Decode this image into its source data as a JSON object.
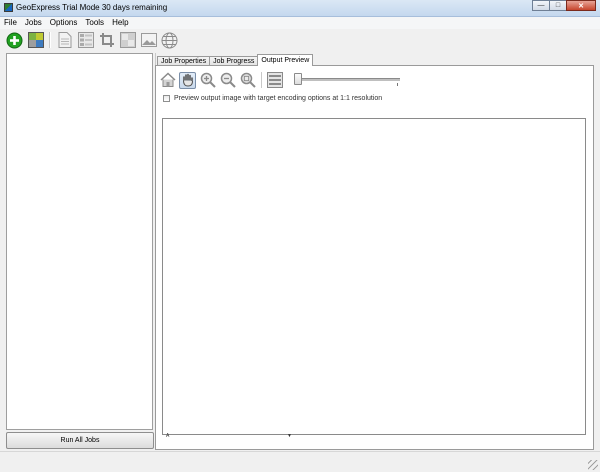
{
  "window": {
    "title": "GeoExpress Trial Mode 30 days remaining",
    "controls": {
      "minimize": "—",
      "maximize": "□",
      "close": "✕"
    }
  },
  "menu": [
    "File",
    "Jobs",
    "Options",
    "Tools",
    "Help"
  ],
  "toolbar": {
    "icons": [
      "add-job-icon",
      "mosaic-icon",
      "document-icon",
      "list-icon",
      "crop-icon",
      "image-gray-icon",
      "picture-icon",
      "globe-icon"
    ]
  },
  "left_panel": {
    "run_all_label": "Run All Jobs"
  },
  "tabs": [
    {
      "label": "Job Properties",
      "active": false
    },
    {
      "label": "Job Progress",
      "active": false
    },
    {
      "label": "Output Preview",
      "active": true
    }
  ],
  "preview": {
    "tools": [
      "home-icon",
      "hand-pan-icon",
      "zoom-in-icon",
      "zoom-out-icon",
      "zoom-fit-icon",
      "layers-icon"
    ],
    "active_tool": "hand-pan-icon",
    "zoom_slider_value": 0,
    "option_label": "Preview output image with target encoding options at 1:1 resolution",
    "option_checked": false,
    "marker_left": "A",
    "marker_mid": "▼"
  },
  "colors": {
    "add_green": "#21a121",
    "title_bar": "#c4d8ee",
    "close_red": "#c7452d"
  }
}
